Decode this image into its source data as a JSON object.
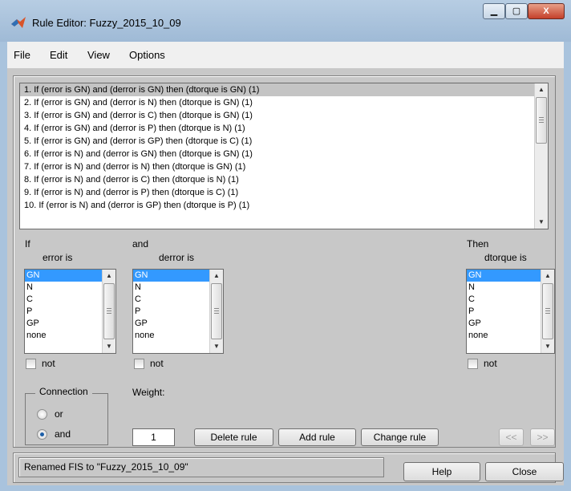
{
  "window": {
    "title": "Rule Editor: Fuzzy_2015_10_09",
    "minimize": "▁",
    "maximize": "▢",
    "close": "X"
  },
  "menu": [
    "File",
    "Edit",
    "View",
    "Options"
  ],
  "rules": [
    "1. If (error is GN) and (derror is GN) then (dtorque is GN) (1)",
    "2. If (error is GN) and (derror is N) then (dtorque is GN) (1)",
    "3. If (error is GN) and (derror is C) then (dtorque is GN) (1)",
    "4. If (error is GN) and (derror is P) then (dtorque is N) (1)",
    "5. If (error is GN) and (derror is GP) then (dtorque is C) (1)",
    "6. If (error is N) and (derror is GN) then (dtorque is GN) (1)",
    "7. If (error is N) and (derror is N) then (dtorque is GN) (1)",
    "8. If (error is N) and (derror is C) then (dtorque is N) (1)",
    "9. If (error is N) and (derror is P) then (dtorque is C) (1)",
    "10. If (error is N) and (derror is GP) then (dtorque is P) (1)"
  ],
  "antecedent1": {
    "header": "If",
    "label": "error is",
    "options": [
      "GN",
      "N",
      "C",
      "P",
      "GP",
      "none"
    ],
    "selected": "GN",
    "not_label": "not"
  },
  "antecedent2": {
    "header": "and",
    "label": "derror is",
    "options": [
      "GN",
      "N",
      "C",
      "P",
      "GP",
      "none"
    ],
    "selected": "GN",
    "not_label": "not"
  },
  "consequent": {
    "header": "Then",
    "label": "dtorque is",
    "options": [
      "GN",
      "N",
      "C",
      "P",
      "GP",
      "none"
    ],
    "selected": "GN",
    "not_label": "not"
  },
  "connection": {
    "label": "Connection",
    "or_label": "or",
    "and_label": "and",
    "selected": "and"
  },
  "weight": {
    "label": "Weight:",
    "value": "1"
  },
  "buttons": {
    "delete": "Delete rule",
    "add": "Add rule",
    "change": "Change rule",
    "prev": "<<",
    "next": ">>",
    "help": "Help",
    "close": "Close"
  },
  "status": "Renamed FIS to \"Fuzzy_2015_10_09\""
}
